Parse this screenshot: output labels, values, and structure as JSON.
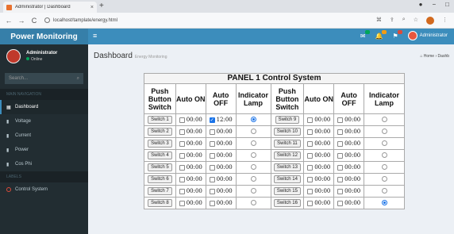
{
  "browser": {
    "tab_title": "Administrator | Dashboard",
    "url": "localhost/tamplate/energy.html",
    "new_tab": "+",
    "close": "×",
    "back": "←",
    "forward": "→",
    "reload": "C"
  },
  "app": {
    "logo": "Power Monitoring",
    "toggle": "≡",
    "user_name": "Administrator",
    "accent_color": "#3c8dbc",
    "sidebar_bg": "#222d32"
  },
  "sidebar": {
    "user": "Administrator",
    "status": "Online",
    "search_placeholder": "Search...",
    "main_header": "MAIN NAVIGATION",
    "items": [
      {
        "label": "Dashboard",
        "icon": "dashboard-icon",
        "active": true
      },
      {
        "label": "Voltage",
        "icon": "chart-icon"
      },
      {
        "label": "Current",
        "icon": "chart-icon"
      },
      {
        "label": "Power",
        "icon": "chart-icon"
      },
      {
        "label": "Cos Phi",
        "icon": "chart-icon"
      }
    ],
    "labels_header": "LABELS",
    "control": "Control System"
  },
  "content": {
    "title": "Dashboard",
    "subtitle": "Energy Monitoring",
    "breadcrumb_home": "Home",
    "breadcrumb_current": "Dashb"
  },
  "panel": {
    "title": "PANEL 1 Control System",
    "headers": [
      "Push Button Switch",
      "Auto ON",
      "Auto OFF",
      "Indicator Lamp"
    ],
    "left": [
      {
        "name": "Switch 1",
        "on": "00:00",
        "on_checked": false,
        "off": "12:00",
        "off_checked": true,
        "lamp": true
      },
      {
        "name": "Switch 2",
        "on": "00:00",
        "on_checked": false,
        "off": "00:00",
        "off_checked": false,
        "lamp": false
      },
      {
        "name": "Switch 3",
        "on": "00:00",
        "on_checked": false,
        "off": "00:00",
        "off_checked": false,
        "lamp": false
      },
      {
        "name": "Switch 4",
        "on": "00:00",
        "on_checked": false,
        "off": "00:00",
        "off_checked": false,
        "lamp": false
      },
      {
        "name": "Switch 5",
        "on": "00:00",
        "on_checked": false,
        "off": "00:00",
        "off_checked": false,
        "lamp": false
      },
      {
        "name": "Switch 6",
        "on": "00:00",
        "on_checked": false,
        "off": "00:00",
        "off_checked": false,
        "lamp": false
      },
      {
        "name": "Switch 7",
        "on": "00:00",
        "on_checked": false,
        "off": "00:00",
        "off_checked": false,
        "lamp": false
      },
      {
        "name": "Switch 8",
        "on": "00:00",
        "on_checked": false,
        "off": "00:00",
        "off_checked": false,
        "lamp": false
      }
    ],
    "right": [
      {
        "name": "Switch 9",
        "on": "00:00",
        "on_checked": false,
        "off": "00:00",
        "off_checked": false,
        "lamp": false
      },
      {
        "name": "Switch 10",
        "on": "00:00",
        "on_checked": false,
        "off": "00:00",
        "off_checked": false,
        "lamp": false
      },
      {
        "name": "Switch 11",
        "on": "00:00",
        "on_checked": false,
        "off": "00:00",
        "off_checked": false,
        "lamp": false
      },
      {
        "name": "Switch 12",
        "on": "00:00",
        "on_checked": false,
        "off": "00:00",
        "off_checked": false,
        "lamp": false
      },
      {
        "name": "Switch 13",
        "on": "00:00",
        "on_checked": false,
        "off": "00:00",
        "off_checked": false,
        "lamp": false
      },
      {
        "name": "Switch 14",
        "on": "00:00",
        "on_checked": false,
        "off": "00:00",
        "off_checked": false,
        "lamp": false
      },
      {
        "name": "Switch 15",
        "on": "00:00",
        "on_checked": false,
        "off": "00:00",
        "off_checked": false,
        "lamp": false
      },
      {
        "name": "Switch 16",
        "on": "00:00",
        "on_checked": false,
        "off": "00:00",
        "off_checked": false,
        "lamp": true
      }
    ]
  }
}
